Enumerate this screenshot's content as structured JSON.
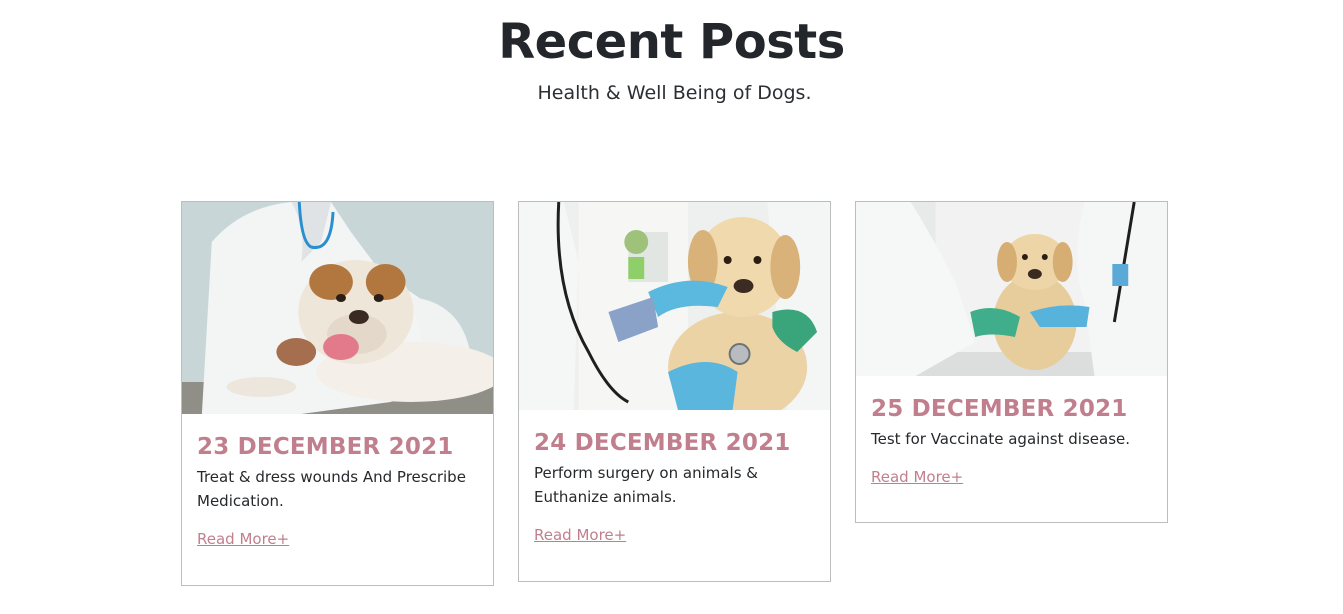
{
  "section": {
    "title": "Recent Posts",
    "subtitle": "Health & Well Being of Dogs."
  },
  "posts": [
    {
      "image": "vet-examining-bulldog-photo",
      "date": "23 DECEMBER 2021",
      "excerpt": "Treat & dress wounds And Prescribe Medication.",
      "link": "Read More+"
    },
    {
      "image": "vet-stethoscope-labrador-puppy-photo",
      "date": "24 DECEMBER 2021",
      "excerpt": "Perform surgery on animals & Euthanize animals.",
      "link": "Read More+"
    },
    {
      "image": "vets-holding-labrador-puppy-photo",
      "date": "25 DECEMBER 2021",
      "excerpt": "Test for Vaccinate against disease.",
      "link": "Read More+"
    }
  ],
  "colors": {
    "accent": "#c17f8e",
    "heading": "#23272b",
    "border": "#bdbdbd"
  }
}
